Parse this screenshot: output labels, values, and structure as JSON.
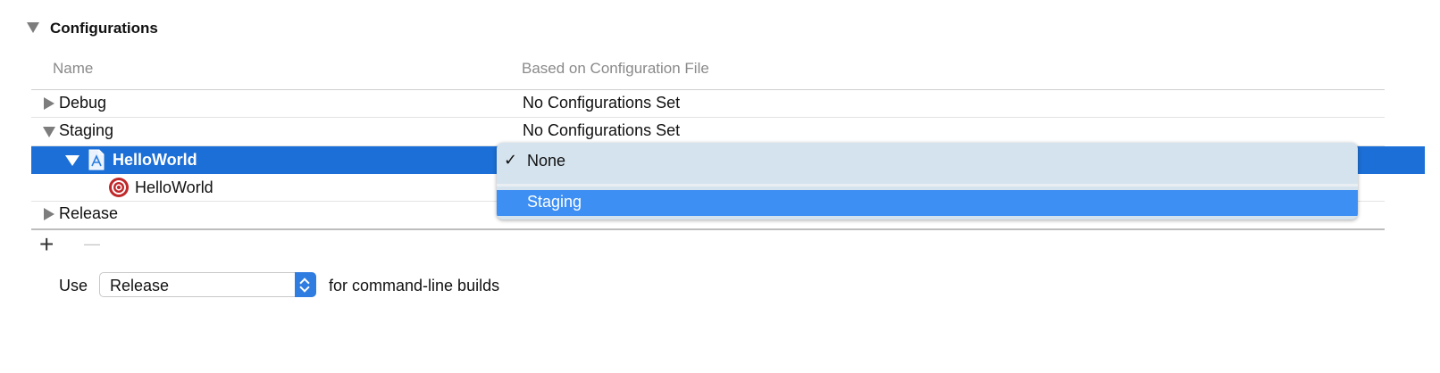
{
  "section": {
    "title": "Configurations"
  },
  "columns": {
    "name": "Name",
    "based_on": "Based on Configuration File"
  },
  "rows": [
    {
      "label": "Debug",
      "value": "No Configurations Set"
    },
    {
      "label": "Staging",
      "value": "No Configurations Set"
    },
    {
      "label": "HelloWorld"
    },
    {
      "label": "HelloWorld"
    },
    {
      "label": "Release"
    }
  ],
  "popup": {
    "items": [
      {
        "label": "None",
        "checked": true
      },
      {
        "label": "Staging",
        "highlighted": true
      }
    ],
    "check_glyph": "✓"
  },
  "buttons": {
    "add": "+",
    "remove": "—"
  },
  "command_line": {
    "prefix": "Use",
    "selected": "Release",
    "suffix": "for command-line builds"
  },
  "colors": {
    "selection": "#1c6fd6",
    "menu_highlight": "#3d8ff3",
    "menu_background": "#d5e3ee",
    "target_icon": "#c0282a",
    "stepper": "#2f7de0"
  }
}
